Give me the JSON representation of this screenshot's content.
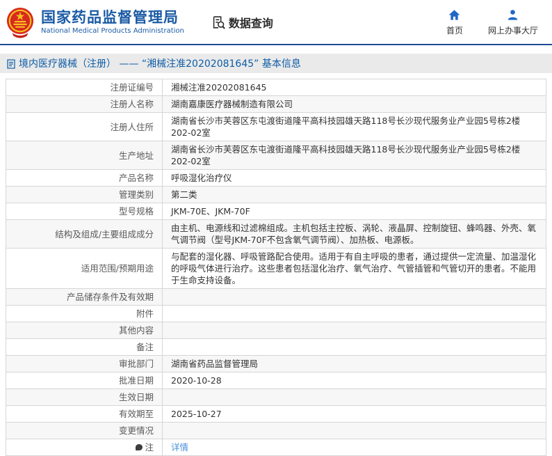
{
  "header": {
    "logo": "national-emblem",
    "title_cn": "国家药品监督管理局",
    "title_en": "National Medical Products Administration",
    "section_label": "数据查询",
    "nav": [
      {
        "icon": "home-icon",
        "label": "首页"
      },
      {
        "icon": "person-icon",
        "label": "网上办事大厅"
      }
    ]
  },
  "breadcrumb": {
    "icon": "document-icon",
    "text": "境内医疗器械（注册） —— “湘械注准20202081645” 基本信息"
  },
  "colors": {
    "brand_blue": "#1a5aa5",
    "nav_icon_blue": "#2166c6",
    "header_rule_navy": "#1f4c94",
    "breadcrumb_bg": "#eaeaea",
    "breadcrumb_text": "#0d5ca5",
    "link_blue": "#4a90d9",
    "row_alt_bg": "#f7f7f7",
    "emblem_red": "#d8291f",
    "emblem_gold": "#f5c31f"
  },
  "table": {
    "rows": [
      {
        "label": "注册证编号",
        "value": "湘械注准20202081645"
      },
      {
        "label": "注册人名称",
        "value": "湖南嘉康医疗器械制造有限公司"
      },
      {
        "label": "注册人住所",
        "value": "湖南省长沙市芙蓉区东屯渡街道隆平高科技园雄天路118号长沙现代服务业产业园5号栋2楼202-02室"
      },
      {
        "label": "生产地址",
        "value": "湖南省长沙市芙蓉区东屯渡街道隆平高科技园雄天路118号长沙现代服务业产业园5号栋2楼202-02室"
      },
      {
        "label": "产品名称",
        "value": "呼吸湿化治疗仪"
      },
      {
        "label": "管理类别",
        "value": "第二类"
      },
      {
        "label": "型号规格",
        "value": "JKM-70E、JKM-70F"
      },
      {
        "label": "结构及组成/主要组成成分",
        "value": "由主机、电源线和过滤棉组成。主机包括主控板、涡轮、液晶屏、控制旋钮、蜂鸣器、外壳、氧气调节阀（型号JKM-70F不包含氧气调节阀）、加热板、电源板。"
      },
      {
        "label": "适用范围/预期用途",
        "value": "与配套的湿化器、呼吸管路配合使用。适用于有自主呼吸的患者，通过提供一定流量、加温湿化的呼吸气体进行治疗。这些患者包括湿化治疗、氧气治疗、气管插管和气管切开的患者。不能用于生命支持设备。"
      },
      {
        "label": "产品储存条件及有效期",
        "value": ""
      },
      {
        "label": "附件",
        "value": ""
      },
      {
        "label": "其他内容",
        "value": ""
      },
      {
        "label": "备注",
        "value": ""
      },
      {
        "label": "审批部门",
        "value": "湖南省药品监督管理局"
      },
      {
        "label": "批准日期",
        "value": "2020-10-28"
      },
      {
        "label": "生效日期",
        "value": ""
      },
      {
        "label": "有效期至",
        "value": "2025-10-27"
      },
      {
        "label": "变更情况",
        "value": ""
      },
      {
        "label": "注",
        "label_icon": "note-icon",
        "value": "详情",
        "link": true
      }
    ]
  }
}
